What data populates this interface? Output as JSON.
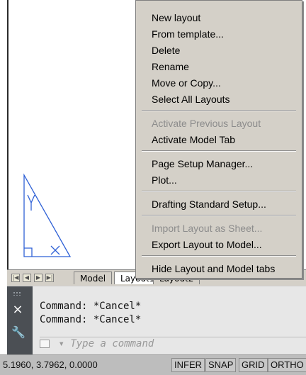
{
  "tabs": {
    "nav": [
      "|◀",
      "◀",
      "▶",
      "▶|"
    ],
    "model": "Model",
    "layout1": "Layout1",
    "layout2": "Layout2"
  },
  "context_menu": {
    "items": [
      {
        "label": "New layout",
        "enabled": true
      },
      {
        "label": "From template...",
        "enabled": true
      },
      {
        "label": "Delete",
        "enabled": true
      },
      {
        "label": "Rename",
        "enabled": true
      },
      {
        "label": "Move or Copy...",
        "enabled": true
      },
      {
        "label": "Select All Layouts",
        "enabled": true
      },
      {
        "label": "Activate Previous Layout",
        "enabled": false
      },
      {
        "label": "Activate Model Tab",
        "enabled": true
      },
      {
        "label": "Page Setup Manager...",
        "enabled": true
      },
      {
        "label": "Plot...",
        "enabled": true
      },
      {
        "label": "Drafting Standard Setup...",
        "enabled": true
      },
      {
        "label": "Import Layout as Sheet...",
        "enabled": false
      },
      {
        "label": "Export Layout to Model...",
        "enabled": true
      },
      {
        "label": "Hide Layout and Model tabs",
        "enabled": true
      }
    ]
  },
  "command": {
    "history": [
      "Command: *Cancel*",
      "Command: *Cancel*"
    ],
    "input_placeholder": "Type a command",
    "prompt_symbol": "▾"
  },
  "status": {
    "coordinates": "5.1960, 3.7962, 0.0000",
    "toggles": [
      "INFER",
      "SNAP",
      "GRID",
      "ORTHO"
    ]
  },
  "icons": {
    "close_icon": "×",
    "wrench_icon": "🔧"
  },
  "colors": {
    "drawing_line": "#2f61d6",
    "menu_bg": "#d4d0c8",
    "command_bg": "#e7e7e7",
    "gripper_bg": "#4b4f54"
  }
}
